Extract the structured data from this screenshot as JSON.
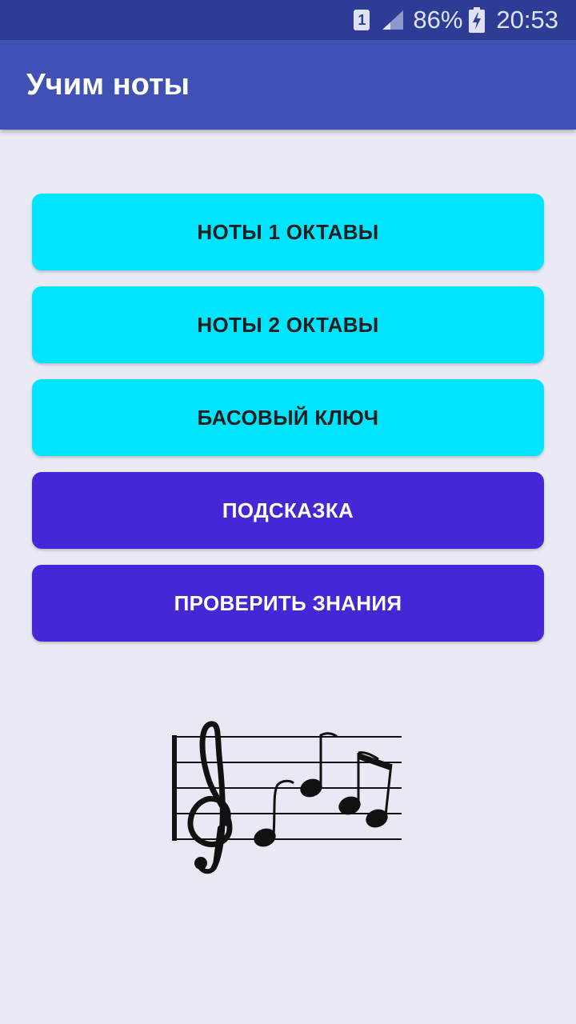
{
  "status_bar": {
    "sim_label": "1",
    "battery_percent": "86%",
    "time": "20:53"
  },
  "app_bar": {
    "title": "Учим ноты"
  },
  "buttons": [
    {
      "label": "НОТЫ 1 ОКТАВЫ",
      "style": "light"
    },
    {
      "label": "НОТЫ 2 ОКТАВЫ",
      "style": "light"
    },
    {
      "label": "БАСОВЫЙ КЛЮЧ",
      "style": "light"
    },
    {
      "label": "ПОДСКАЗКА",
      "style": "dark"
    },
    {
      "label": "ПРОВЕРИТЬ ЗНАНИЯ",
      "style": "dark"
    }
  ],
  "colors": {
    "status_bar": "#2e3c95",
    "app_bar": "#3f51b5",
    "background": "#e9e9f5",
    "button_light": "#00e5ff",
    "button_dark": "#4527d6"
  },
  "icons": {
    "sim": "sim-1-icon",
    "signal": "signal-icon",
    "battery": "battery-charging-icon",
    "music": "treble-clef-notes-image"
  }
}
